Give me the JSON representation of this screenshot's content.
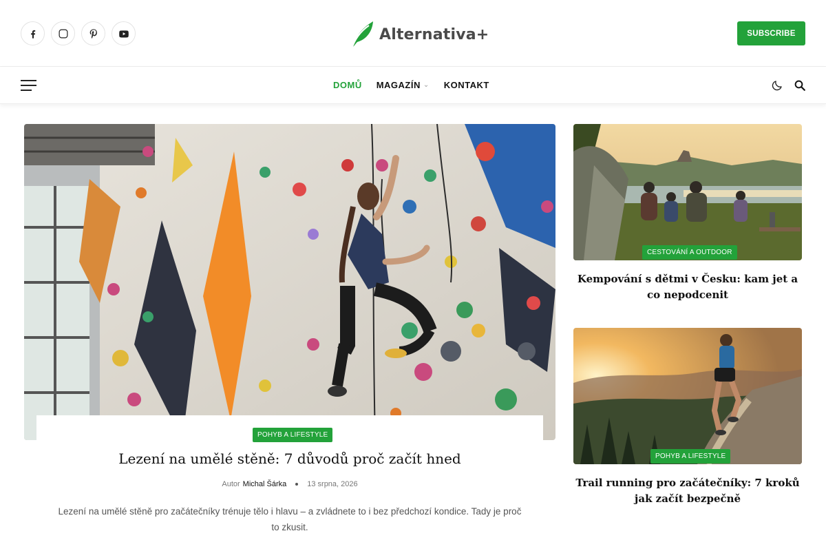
{
  "header": {
    "logo_text": "Alternativa+",
    "subscribe_label": "SUBSCRIBE",
    "socials": [
      "facebook-icon",
      "instagram-icon",
      "pinterest-icon",
      "youtube-icon"
    ],
    "accent_color": "#23a23a"
  },
  "nav": {
    "items": [
      {
        "label": "DOMŮ",
        "active": true
      },
      {
        "label": "MAGAZÍN",
        "has_dropdown": true,
        "caret": "⌄"
      },
      {
        "label": "KONTAKT"
      }
    ]
  },
  "featured": {
    "category": "POHYB A LIFESTYLE",
    "title": "Lezení na umělé stěně: 7 důvodů proč začít hned",
    "author_prefix": "Autor",
    "author": "Michal Šárka",
    "date": "13 srpna, 2026",
    "excerpt": "Lezení na umělé stěně pro začátečníky trénuje tělo i hlavu – a zvládnete to i bez předchozí kondice. Tady je proč to zkusit."
  },
  "side_posts": [
    {
      "category": "CESTOVÁNÍ A OUTDOOR",
      "title": "Kempování s dětmi v Česku: kam jet a co nepodcenit"
    },
    {
      "category": "POHYB A LIFESTYLE",
      "title": "Trail running pro začátečníky: 7 kroků jak začít bezpečně"
    }
  ]
}
